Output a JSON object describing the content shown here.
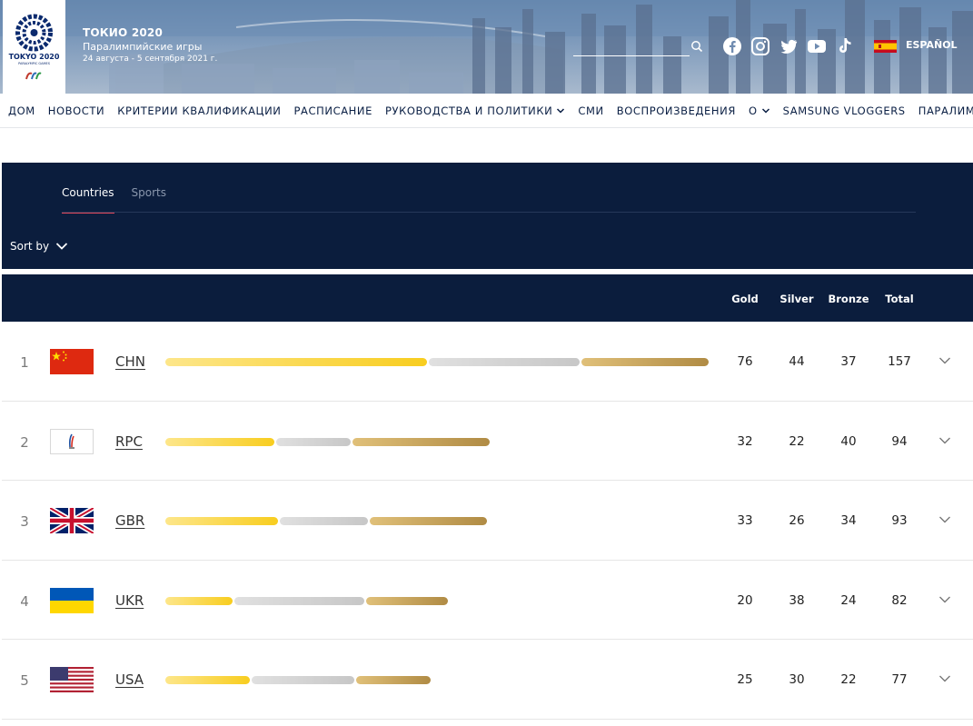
{
  "header": {
    "title": "ТОКИО 2020",
    "subtitle": "Паралимпийские игры",
    "dates": "24 августа - 5 сентября 2021 г.",
    "logo_text": "TOKYO 2020",
    "logo_subtext": "PARALYMPIC GAMES",
    "language": "ESPAÑOL",
    "search_placeholder": "",
    "social_icons": [
      "facebook-icon",
      "instagram-icon",
      "twitter-icon",
      "youtube-icon",
      "tiktok-icon"
    ]
  },
  "nav": {
    "items": [
      {
        "label": "ДОМ"
      },
      {
        "label": "НОВОСТИ"
      },
      {
        "label": "КРИТЕРИИ КВАЛИФИКАЦИИ"
      },
      {
        "label": "РАСПИСАНИЕ"
      },
      {
        "label": "РУКОВОДСТВА И ПОЛИТИКИ"
      },
      {
        "label": "СМИ"
      },
      {
        "label": "ВОСПРОИЗВЕДЕНИЯ"
      },
      {
        "label": "О"
      },
      {
        "label": "SAMSUNG VLOGGERS"
      },
      {
        "label": "ПАРАЛИМПИЙ"
      }
    ]
  },
  "tabs": {
    "countries": "Countries",
    "sports": "Sports",
    "active": "Countries"
  },
  "sort": {
    "label": "Sort by"
  },
  "table": {
    "headers": {
      "gold": "Gold",
      "silver": "Silver",
      "bronze": "Bronze",
      "total": "Total"
    },
    "rows": [
      {
        "rank": "1",
        "code": "CHN",
        "flag": "china",
        "gold": "76",
        "silver": "44",
        "bronze": "37",
        "total": "157"
      },
      {
        "rank": "2",
        "code": "RPC",
        "flag": "rpc",
        "gold": "32",
        "silver": "22",
        "bronze": "40",
        "total": "94"
      },
      {
        "rank": "3",
        "code": "GBR",
        "flag": "uk",
        "gold": "33",
        "silver": "26",
        "bronze": "34",
        "total": "93"
      },
      {
        "rank": "4",
        "code": "UKR",
        "flag": "ukraine",
        "gold": "20",
        "silver": "38",
        "bronze": "24",
        "total": "82"
      },
      {
        "rank": "5",
        "code": "USA",
        "flag": "usa",
        "gold": "25",
        "silver": "30",
        "bronze": "22",
        "total": "77"
      }
    ]
  },
  "colors": {
    "navy": "#0b1d3d",
    "tab_accent": "#e2485b",
    "gold": "#f8cd1f",
    "silver": "#c7c7c7",
    "bronze": "#b08b44"
  }
}
